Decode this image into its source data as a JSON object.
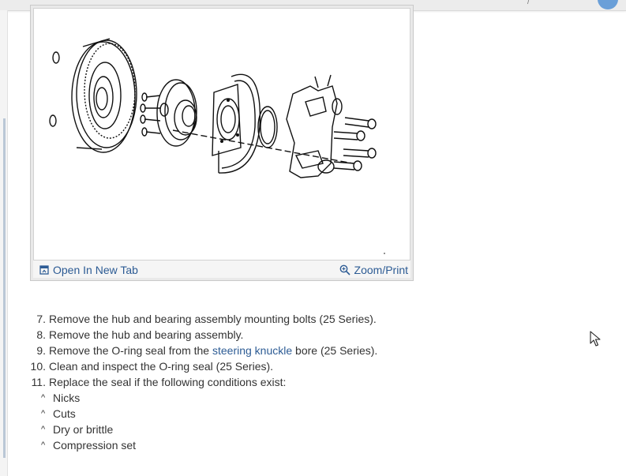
{
  "figure": {
    "open_label": "Open In New Tab",
    "zoom_label": "Zoom/Print",
    "open_icon": "open-in-new-tab-icon",
    "zoom_icon": "magnifier-icon"
  },
  "steps": [
    {
      "num": "7.",
      "text": "Remove the hub and bearing assembly mounting bolts (25 Series)."
    },
    {
      "num": "8.",
      "text": "Remove the hub and bearing assembly."
    },
    {
      "num": "9.",
      "pre": "Remove the O-ring seal from the ",
      "link": "steering knuckle",
      "post": " bore (25 Series)."
    },
    {
      "num": "10.",
      "text": "Clean and inspect the O-ring seal (25 Series)."
    },
    {
      "num": "11.",
      "text": "Replace the seal if the following conditions exist:"
    }
  ],
  "conditions": {
    "marker": "^",
    "items": [
      "Nicks",
      "Cuts",
      "Dry or brittle",
      "Compression set"
    ]
  },
  "colors": {
    "link": "#2c5b94",
    "text": "#333333"
  }
}
